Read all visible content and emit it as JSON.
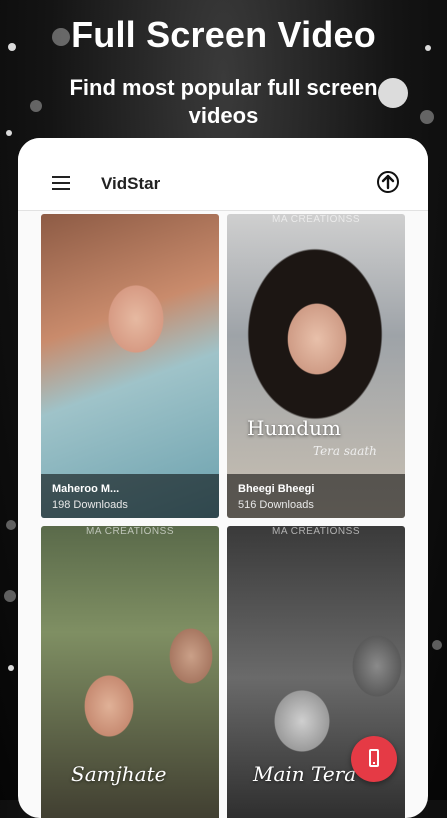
{
  "promo": {
    "headline": "Full Screen Video",
    "subline": "Find most popular full screen videos"
  },
  "app": {
    "title": "VidStar",
    "icons": {
      "menu": "hamburger-menu-icon",
      "upload": "upload-icon",
      "fab": "phone-icon"
    }
  },
  "videos": [
    {
      "title": "Maheroo M...",
      "downloads": "198 Downloads",
      "overlay": "",
      "overlay_sub": "",
      "watermark": ""
    },
    {
      "title": "Bheegi Bheegi",
      "downloads": "516 Downloads",
      "overlay": "Humdum",
      "overlay_sub": "Tera saath",
      "watermark": "MA CREATIONSS"
    },
    {
      "title": "",
      "downloads": "",
      "overlay": "Samjhate",
      "overlay_sub": "",
      "watermark": "MA CREATIONSS"
    },
    {
      "title": "",
      "downloads": "",
      "overlay": "Main Tera",
      "overlay_sub": "",
      "watermark": "MA CREATIONSS"
    }
  ],
  "colors": {
    "fab": "#e53a45",
    "card_info_bg": "rgba(0,0,0,0.55)"
  }
}
